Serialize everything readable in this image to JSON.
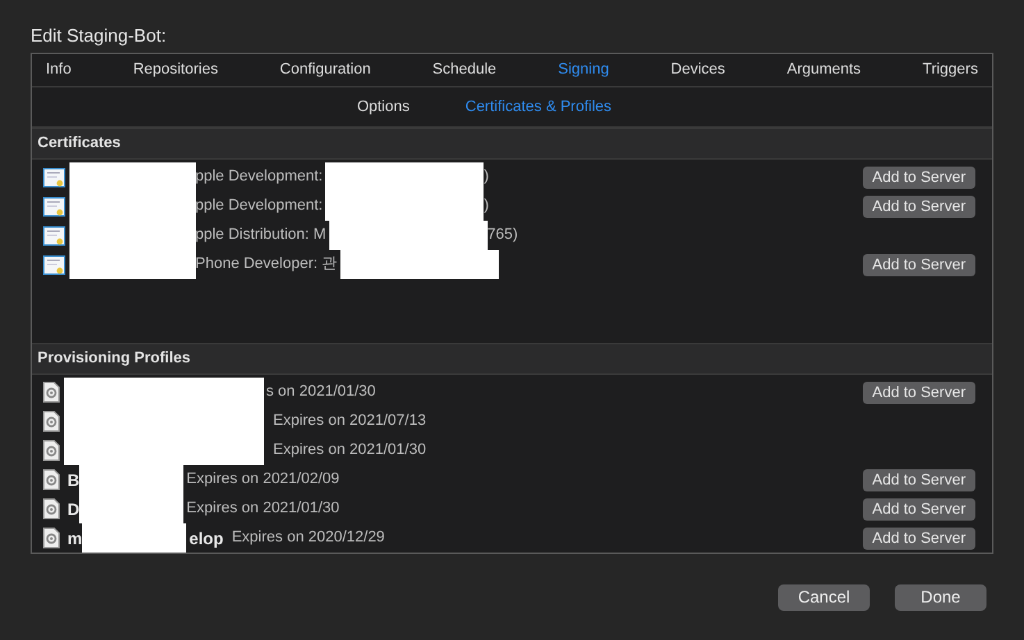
{
  "window": {
    "title": "Edit Staging-Bot:"
  },
  "tabs": [
    {
      "label": "Info",
      "selected": false
    },
    {
      "label": "Repositories",
      "selected": false
    },
    {
      "label": "Configuration",
      "selected": false
    },
    {
      "label": "Schedule",
      "selected": false
    },
    {
      "label": "Signing",
      "selected": true
    },
    {
      "label": "Devices",
      "selected": false
    },
    {
      "label": "Arguments",
      "selected": false
    },
    {
      "label": "Triggers",
      "selected": false
    }
  ],
  "subtabs": [
    {
      "label": "Options",
      "selected": false
    },
    {
      "label": "Certificates & Profiles",
      "selected": true
    }
  ],
  "sections": [
    {
      "title": "Certificates",
      "kind": "certificate",
      "rows": [
        {
          "parts": [
            {
              "kind": "redacted"
            },
            {
              "kind": "text",
              "text": "pple Development:"
            },
            {
              "kind": "redacted"
            },
            {
              "kind": "text",
              "text": ")"
            }
          ],
          "button": "Add to Server"
        },
        {
          "parts": [
            {
              "kind": "redacted"
            },
            {
              "kind": "text",
              "text": "pple Development:"
            },
            {
              "kind": "redacted"
            },
            {
              "kind": "text",
              "text": ")"
            }
          ],
          "button": "Add to Server"
        },
        {
          "parts": [
            {
              "kind": "redacted"
            },
            {
              "kind": "text",
              "text": "pple Distribution: M"
            },
            {
              "kind": "redacted"
            },
            {
              "kind": "text",
              "text": "765)"
            }
          ]
        },
        {
          "parts": [
            {
              "kind": "redacted"
            },
            {
              "kind": "text",
              "text": "Phone Developer: 관"
            },
            {
              "kind": "redacted"
            }
          ],
          "button": "Add to Server"
        }
      ]
    },
    {
      "title": "Provisioning Profiles",
      "kind": "profile",
      "rows": [
        {
          "parts": [
            {
              "kind": "redacted"
            },
            {
              "kind": "text",
              "text": "s on 2021/01/30"
            }
          ],
          "button": "Add to Server"
        },
        {
          "parts": [
            {
              "kind": "redacted"
            },
            {
              "kind": "text",
              "text": "Expires on 2021/07/13"
            }
          ]
        },
        {
          "parts": [
            {
              "kind": "redacted"
            },
            {
              "kind": "text",
              "text": "Expires on 2021/01/30"
            }
          ]
        },
        {
          "parts": [
            {
              "kind": "name",
              "text": "B"
            },
            {
              "kind": "redacted"
            },
            {
              "kind": "text",
              "text": "Expires on 2021/02/09"
            }
          ],
          "button": "Add to Server"
        },
        {
          "parts": [
            {
              "kind": "name",
              "text": "D"
            },
            {
              "kind": "redacted"
            },
            {
              "kind": "text",
              "text": "Expires on 2021/01/30"
            }
          ],
          "button": "Add to Server"
        },
        {
          "parts": [
            {
              "kind": "name",
              "text": "m"
            },
            {
              "kind": "redacted"
            },
            {
              "kind": "name",
              "text": "elop"
            },
            {
              "kind": "text",
              "text": "Expires on 2020/12/29"
            }
          ],
          "button": "Add to Server"
        }
      ]
    }
  ],
  "buttons": [
    "Cancel",
    "Done"
  ]
}
